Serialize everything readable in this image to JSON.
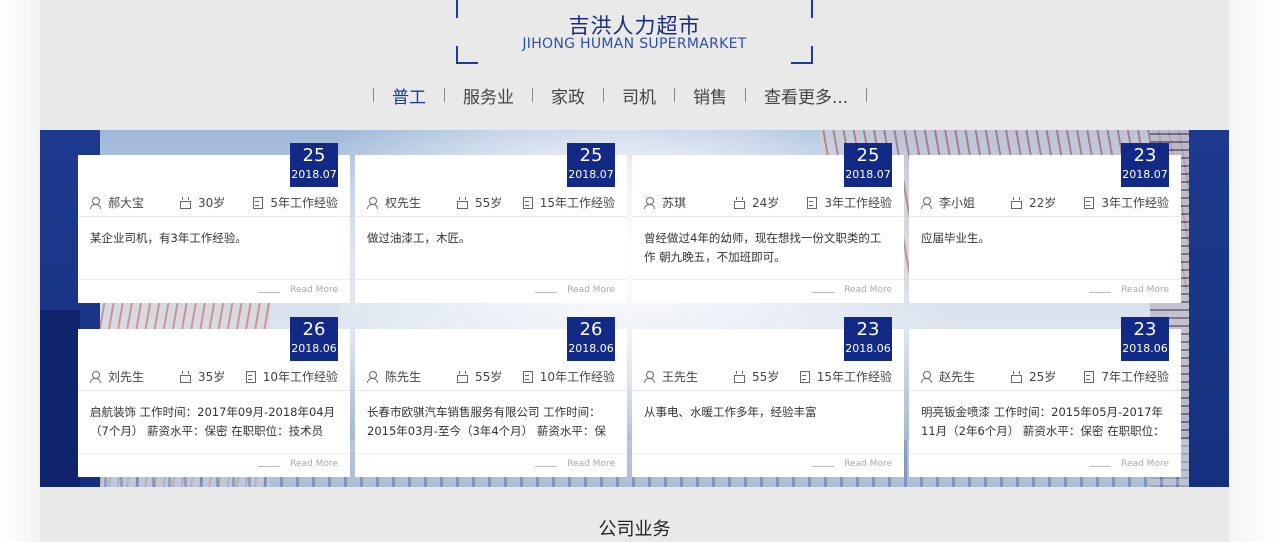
{
  "brand": {
    "title": "吉洪人力超市",
    "subtitle": "JIHONG HUMAN SUPERMARKET"
  },
  "nav": {
    "items": [
      {
        "label": "普工",
        "active": true
      },
      {
        "label": "服务业",
        "active": false
      },
      {
        "label": "家政",
        "active": false
      },
      {
        "label": "司机",
        "active": false
      },
      {
        "label": "销售",
        "active": false
      },
      {
        "label": "查看更多...",
        "active": false
      }
    ]
  },
  "cards": [
    {
      "day": "25",
      "ym": "2018.07",
      "name": "郝大宝",
      "age": "30岁",
      "exp": "5年工作经验",
      "desc": "某企业司机，有3年工作经验。",
      "more": "Read More"
    },
    {
      "day": "25",
      "ym": "2018.07",
      "name": "权先生",
      "age": "55岁",
      "exp": "15年工作经验",
      "desc": "做过油漆工，木匠。",
      "more": "Read More"
    },
    {
      "day": "25",
      "ym": "2018.07",
      "name": "苏琪",
      "age": "24岁",
      "exp": "3年工作经验",
      "desc": "曾经做过4年的幼师，现在想找一份文职类的工作 朝九晚五，不加班即可。",
      "more": "Read More"
    },
    {
      "day": "23",
      "ym": "2018.07",
      "name": "李小姐",
      "age": "22岁",
      "exp": "3年工作经验",
      "desc": "应届毕业生。",
      "more": "Read More"
    },
    {
      "day": "26",
      "ym": "2018.06",
      "name": "刘先生",
      "age": "35岁",
      "exp": "10年工作经验",
      "desc": "启航装饰 工作时间：2017年09月-2018年04月（7个月） 薪资水平：保密 在职职位：技术员 华强电子",
      "more": "Read More"
    },
    {
      "day": "26",
      "ym": "2018.06",
      "name": "陈先生",
      "age": "55岁",
      "exp": "10年工作经验",
      "desc": "长春市欧骐汽车销售服务有限公司 工作时间：2015年03月-至今（3年4个月） 薪资水平：保密 在职职",
      "more": "Read More"
    },
    {
      "day": "23",
      "ym": "2018.06",
      "name": "王先生",
      "age": "55岁",
      "exp": "15年工作经验",
      "desc": "从事电、水暖工作多年，经验丰富",
      "more": "Read More"
    },
    {
      "day": "23",
      "ym": "2018.06",
      "name": "赵先生",
      "age": "25岁",
      "exp": "7年工作经验",
      "desc": "明亮钣金喷漆 工作时间：2015年05月-2017年11月（2年6个月） 薪资水平：保密 在职职位：技工",
      "more": "Read More"
    }
  ],
  "section": {
    "title": "公司业务"
  },
  "icons": {
    "name": "person-icon",
    "age": "cake-icon",
    "exp": "document-icon"
  },
  "colors": {
    "accent": "#122a86",
    "brand_text": "#1a2c7a",
    "page_bg": "#e9e9ea"
  }
}
